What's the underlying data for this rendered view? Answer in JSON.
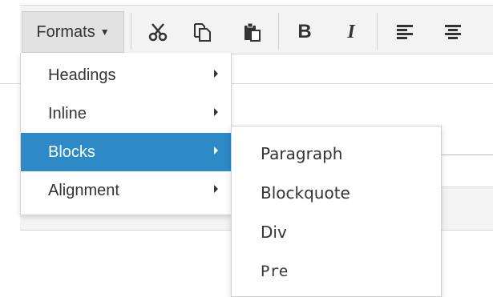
{
  "toolbar": {
    "formats_label": "Formats",
    "icons": [
      "cut-icon",
      "copy-icon",
      "paste-icon",
      "bold-icon",
      "italic-icon",
      "align-left-icon",
      "align-center-icon"
    ],
    "bold_glyph": "B",
    "italic_glyph": "I"
  },
  "menu": {
    "items": [
      {
        "label": "Headings"
      },
      {
        "label": "Inline"
      },
      {
        "label": "Blocks"
      },
      {
        "label": "Alignment"
      }
    ],
    "active_index": 2
  },
  "submenu": {
    "items": [
      {
        "label": "Paragraph"
      },
      {
        "label": "Blockquote"
      },
      {
        "label": "Div"
      },
      {
        "label": "Pre"
      }
    ]
  },
  "colors": {
    "accent": "#2d8ac7",
    "toolbar_bg": "#f3f3f3",
    "text": "#333333"
  }
}
